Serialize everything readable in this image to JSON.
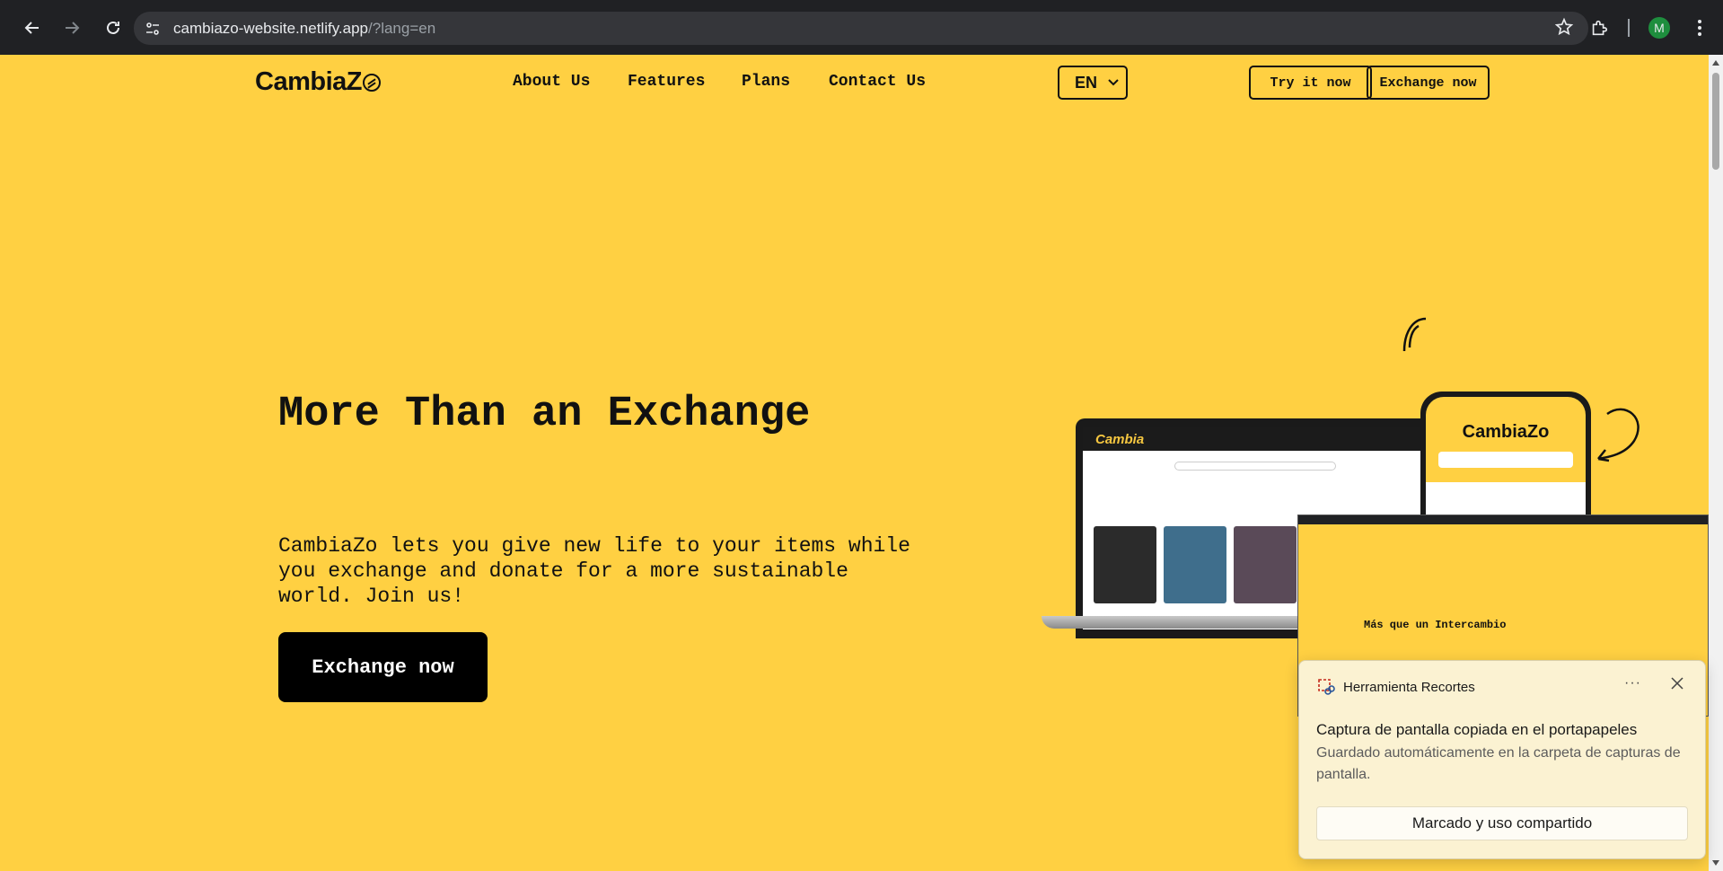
{
  "browser": {
    "url_host": "cambiazo-website.netlify.app",
    "url_rest": "/?lang=en",
    "profile_initial": "M",
    "icons": [
      "back-arrow-icon",
      "forward-arrow-icon",
      "reload-icon",
      "site-info-icon",
      "star-icon",
      "extensions-icon",
      "menu-icon"
    ]
  },
  "header": {
    "logo": "CambiaZ",
    "nav": [
      "About Us",
      "Features",
      "Plans",
      "Contact Us"
    ],
    "language": "EN",
    "try_button": "Try it now",
    "exchange_button": "Exchange now"
  },
  "hero": {
    "title": "More Than an Exchange",
    "text": "CambiaZo lets you give new life to your items while you exchange and donate for a more sustainable world. Join us!",
    "button": "Exchange now"
  },
  "illustration": {
    "laptop_brand": "Cambia",
    "phone_brand": "CambiaZo",
    "mini_title": "Más que un Intercambio"
  },
  "toast": {
    "app_name": "Herramienta Recortes",
    "more": "···",
    "heading": "Captura de pantalla copiada en el portapapeles",
    "body": "Guardado automáticamente en la carpeta de capturas de pantalla.",
    "action": "Marcado y uso compartido"
  },
  "colors": {
    "page_bg": "#ffd042",
    "text": "#111111",
    "chrome_bg": "#202124",
    "toast_bg": "#fbf2d2"
  }
}
